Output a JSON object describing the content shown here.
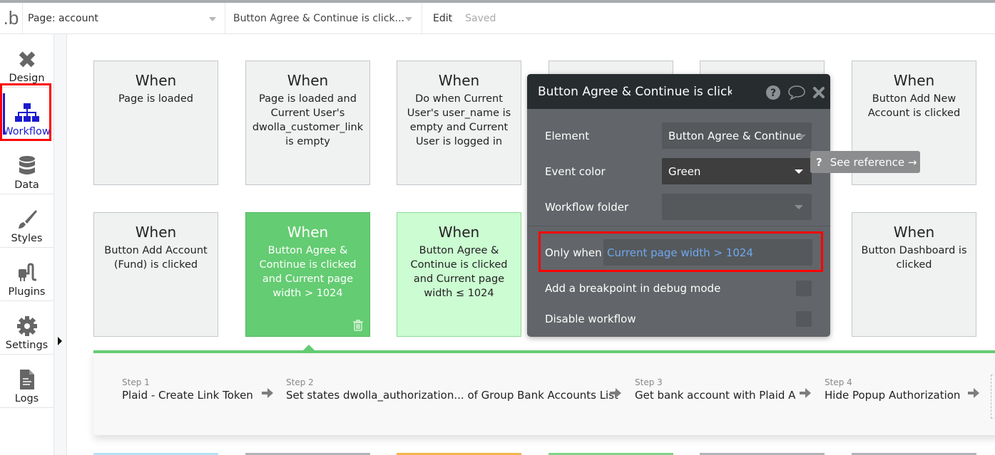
{
  "topbar": {
    "logo": ".b",
    "page_selector": "Page: account",
    "workflow_selector": "Button Agree & Continue is click...",
    "edit_label": "Edit",
    "saved_label": "Saved"
  },
  "sidebar": {
    "items": [
      {
        "label": "Design",
        "icon": "design-icon",
        "active": false
      },
      {
        "label": "Workflow",
        "icon": "workflow-icon",
        "active": true
      },
      {
        "label": "Data",
        "icon": "database-icon",
        "active": false
      },
      {
        "label": "Styles",
        "icon": "brush-icon",
        "active": false
      },
      {
        "label": "Plugins",
        "icon": "plug-icon",
        "active": false
      },
      {
        "label": "Settings",
        "icon": "gear-icon",
        "active": false
      },
      {
        "label": "Logs",
        "icon": "document-icon",
        "active": false
      }
    ]
  },
  "events": [
    {
      "when": "When",
      "desc": "Page is loaded",
      "color": "gray"
    },
    {
      "when": "When",
      "desc": "Page is loaded and Current User's dwolla_customer_link is empty",
      "color": "gray"
    },
    {
      "when": "When",
      "desc": "Do when Current User's user_name is empty and Current User is logged in",
      "color": "gray"
    },
    {
      "when": "When",
      "desc": "Button Add New Account is clicked",
      "color": "gray"
    },
    {
      "when": "When",
      "desc": "Button Add Account (Fund) is clicked",
      "color": "gray"
    },
    {
      "when": "When",
      "desc": "Button Agree & Continue is clicked and Current page width > 1024",
      "color": "green",
      "selected": true
    },
    {
      "when": "When",
      "desc": "Button Agree & Continue is clicked and Current page width ≤ 1024",
      "color": "lightgreen"
    },
    {
      "when": "When",
      "desc": "Button Dashboard is clicked",
      "color": "gray"
    }
  ],
  "steps": [
    {
      "label": "Step 1",
      "name": "Plaid - Create Link Token"
    },
    {
      "label": "Step 2",
      "name": "Set states dwolla_authorization... of Group Bank Accounts List"
    },
    {
      "label": "Step 3",
      "name": "Get bank account with Plaid A"
    },
    {
      "label": "Step 4",
      "name": "Hide Popup Authorization"
    }
  ],
  "popup": {
    "title": "Button Agree & Continue is clicked",
    "element_label": "Element",
    "element_value": "Button Agree & Continue",
    "event_color_label": "Event color",
    "event_color_value": "Green",
    "workflow_folder_label": "Workflow folder",
    "workflow_folder_value": "",
    "only_when_label": "Only when",
    "only_when_value": "Current page width > 1024",
    "breakpoint_label": "Add a breakpoint in debug mode",
    "breakpoint_checked": false,
    "disable_label": "Disable workflow",
    "disable_checked": false
  },
  "tooltip": {
    "icon": "?",
    "text": "See reference →"
  },
  "colors": {
    "accent_green": "#64cc72",
    "light_green": "#ccfcd2",
    "workflow_blue": "#1a1ad0",
    "highlight_red": "#ff0000",
    "condition_blue": "#6fa8ef"
  }
}
